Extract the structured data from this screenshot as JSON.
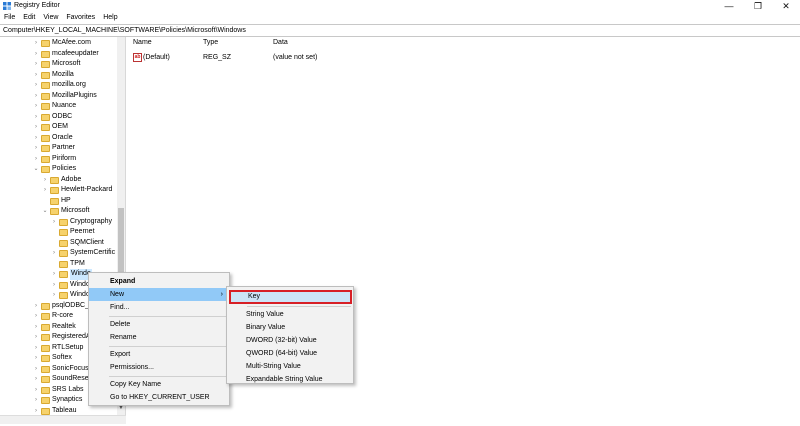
{
  "window": {
    "title": "Registry Editor",
    "minimize": "—",
    "maximize": "❐",
    "close": "✕"
  },
  "menubar": [
    "File",
    "Edit",
    "View",
    "Favorites",
    "Help"
  ],
  "address": "Computer\\HKEY_LOCAL_MACHINE\\SOFTWARE\\Policies\\Microsoft\\Windows",
  "tree": [
    {
      "label": "McAfee.com",
      "depth": 0,
      "arrow": ">"
    },
    {
      "label": "mcafeeupdater",
      "depth": 0,
      "arrow": ">"
    },
    {
      "label": "Microsoft",
      "depth": 0,
      "arrow": ">"
    },
    {
      "label": "Mozilla",
      "depth": 0,
      "arrow": ">"
    },
    {
      "label": "mozilla.org",
      "depth": 0,
      "arrow": ">"
    },
    {
      "label": "MozillaPlugins",
      "depth": 0,
      "arrow": ">"
    },
    {
      "label": "Nuance",
      "depth": 0,
      "arrow": ">"
    },
    {
      "label": "ODBC",
      "depth": 0,
      "arrow": ">"
    },
    {
      "label": "OEM",
      "depth": 0,
      "arrow": ">"
    },
    {
      "label": "Oracle",
      "depth": 0,
      "arrow": ">"
    },
    {
      "label": "Partner",
      "depth": 0,
      "arrow": ">"
    },
    {
      "label": "Piriform",
      "depth": 0,
      "arrow": ">"
    },
    {
      "label": "Policies",
      "depth": 0,
      "arrow": "v"
    },
    {
      "label": "Adobe",
      "depth": 1,
      "arrow": ">"
    },
    {
      "label": "Hewlett-Packard",
      "depth": 1,
      "arrow": ">"
    },
    {
      "label": "HP",
      "depth": 1,
      "arrow": ""
    },
    {
      "label": "Microsoft",
      "depth": 1,
      "arrow": "v"
    },
    {
      "label": "Cryptography",
      "depth": 2,
      "arrow": ">"
    },
    {
      "label": "Peernet",
      "depth": 2,
      "arrow": ""
    },
    {
      "label": "SQMClient",
      "depth": 2,
      "arrow": ""
    },
    {
      "label": "SystemCertific",
      "depth": 2,
      "arrow": ">"
    },
    {
      "label": "TPM",
      "depth": 2,
      "arrow": ""
    },
    {
      "label": "Windo",
      "depth": 2,
      "arrow": ">",
      "selected": true
    },
    {
      "label": "Windo",
      "depth": 2,
      "arrow": ">"
    },
    {
      "label": "Windo",
      "depth": 2,
      "arrow": ">"
    },
    {
      "label": "psqlODBC_x",
      "depth": 0,
      "arrow": ">"
    },
    {
      "label": "R-core",
      "depth": 0,
      "arrow": ">"
    },
    {
      "label": "Realtek",
      "depth": 0,
      "arrow": ">"
    },
    {
      "label": "RegisteredA",
      "depth": 0,
      "arrow": ">"
    },
    {
      "label": "RTLSetup",
      "depth": 0,
      "arrow": ">"
    },
    {
      "label": "Softex",
      "depth": 0,
      "arrow": ">"
    },
    {
      "label": "SonicFocus",
      "depth": 0,
      "arrow": ">"
    },
    {
      "label": "SoundResea",
      "depth": 0,
      "arrow": ">"
    },
    {
      "label": "SRS Labs",
      "depth": 0,
      "arrow": ">"
    },
    {
      "label": "Synaptics",
      "depth": 0,
      "arrow": ">"
    },
    {
      "label": "Tableau",
      "depth": 0,
      "arrow": ">"
    }
  ],
  "list": {
    "columns": [
      "Name",
      "Type",
      "Data"
    ],
    "rows": [
      {
        "name": "(Default)",
        "type": "REG_SZ",
        "data": "(value not set)",
        "icon": "ab"
      }
    ]
  },
  "context_menu": {
    "items": [
      {
        "label": "Expand",
        "bold": true
      },
      {
        "label": "New",
        "submenu": true,
        "highlight": true
      },
      {
        "label": "Find..."
      },
      {
        "sep": true
      },
      {
        "label": "Delete"
      },
      {
        "label": "Rename"
      },
      {
        "sep": true
      },
      {
        "label": "Export"
      },
      {
        "label": "Permissions..."
      },
      {
        "sep": true
      },
      {
        "label": "Copy Key Name"
      },
      {
        "label": "Go to HKEY_CURRENT_USER"
      }
    ],
    "submenu_arrow": "›"
  },
  "submenu": {
    "items": [
      {
        "label": "Key",
        "outlined": true
      },
      {
        "sep": true
      },
      {
        "label": "String Value"
      },
      {
        "label": "Binary Value"
      },
      {
        "label": "DWORD (32-bit) Value"
      },
      {
        "label": "QWORD (64-bit) Value"
      },
      {
        "label": "Multi-String Value"
      },
      {
        "label": "Expandable String Value"
      }
    ]
  },
  "colors": {
    "highlight": "#91c9f7",
    "outline": "#d71f26",
    "folder": "#f6d26c"
  }
}
